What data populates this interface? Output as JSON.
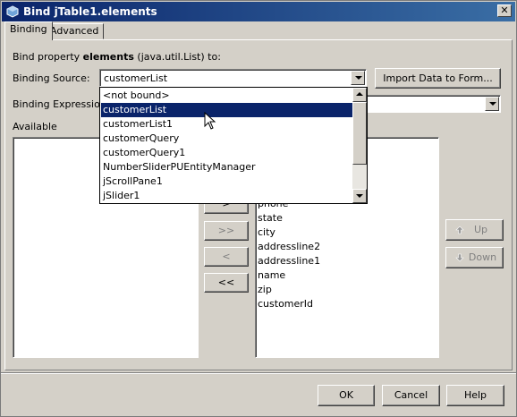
{
  "window": {
    "title": "Bind jTable1.elements",
    "close_label": "✕"
  },
  "tabs": [
    {
      "label": "Binding",
      "active": true
    },
    {
      "label": "Advanced",
      "active": false
    }
  ],
  "binding": {
    "description_prefix": "Bind property ",
    "property_name": "elements",
    "description_suffix": " (java.util.List) to:",
    "source_label": "Binding Source:",
    "source_value": "customerList",
    "import_button": "Import Data to Form...",
    "expression_label": "Binding Expression:",
    "expression_value": "",
    "available_label": "Available"
  },
  "dropdown": {
    "items": [
      "<not bound>",
      "customerList",
      "customerList1",
      "customerQuery",
      "customerQuery1",
      "NumberSliderPUEntityManager",
      "jScrollPane1",
      "jSlider1"
    ],
    "selected_index": 1
  },
  "selected_list": {
    "items": [
      "phone",
      "state",
      "city",
      "addressline2",
      "addressline1",
      "name",
      "zip",
      "customerId"
    ]
  },
  "transfer_buttons": {
    "add": ">",
    "add_all": ">>",
    "remove": "<",
    "remove_all": "<<"
  },
  "order_buttons": {
    "up": "Up",
    "down": "Down"
  },
  "footer": {
    "ok": "OK",
    "cancel": "Cancel",
    "help": "Help"
  },
  "colors": {
    "titlebar": "#0a246a",
    "selection": "#0a246a",
    "window_bg": "#d4d0c8"
  }
}
